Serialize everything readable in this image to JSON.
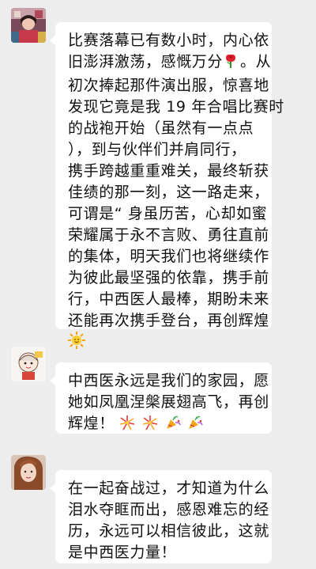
{
  "messages": [
    {
      "lines": [
        "比赛落幕已有数小时，内心依",
        "旧澎湃激荡，感慨万分",
        "初次捧起那件演出服，惊喜地",
        "发现它竟是我 19 年合唱比赛时",
        "的战袍开始（虽然有一点点",
        "），到与伙伴们并肩同行，",
        "携手跨越重重难关，最终斩获",
        "佳绩的那一刻，这一路走来，",
        "可谓是“ 身虽历苦，心却如蜜",
        "荣耀属于永不言败、勇往直前",
        "的集体，明天我们也将继续作",
        "为彼此最坚强的依靠，携手前",
        "行，中西医人最棒，期盼未来",
        "还能再次携手登台，再创辉煌"
      ],
      "inline_after_line2": "。从"
    },
    {
      "lines": [
        "中西医永远是我们的家园，愿",
        "她如凤凰涅槃展翅高飞，再创",
        "辉煌！"
      ]
    },
    {
      "lines": [
        "在一起奋战过，才知道为什么",
        "泪水夺眶而出，感恩难忘的经",
        "历，永远可以相信彼此，这就",
        "是中西医力量！"
      ]
    }
  ],
  "emoji": {
    "rose": "rose-icon",
    "sun": "sun-icon",
    "fireworks": "fireworks-icon",
    "party": "party-popper-icon"
  }
}
